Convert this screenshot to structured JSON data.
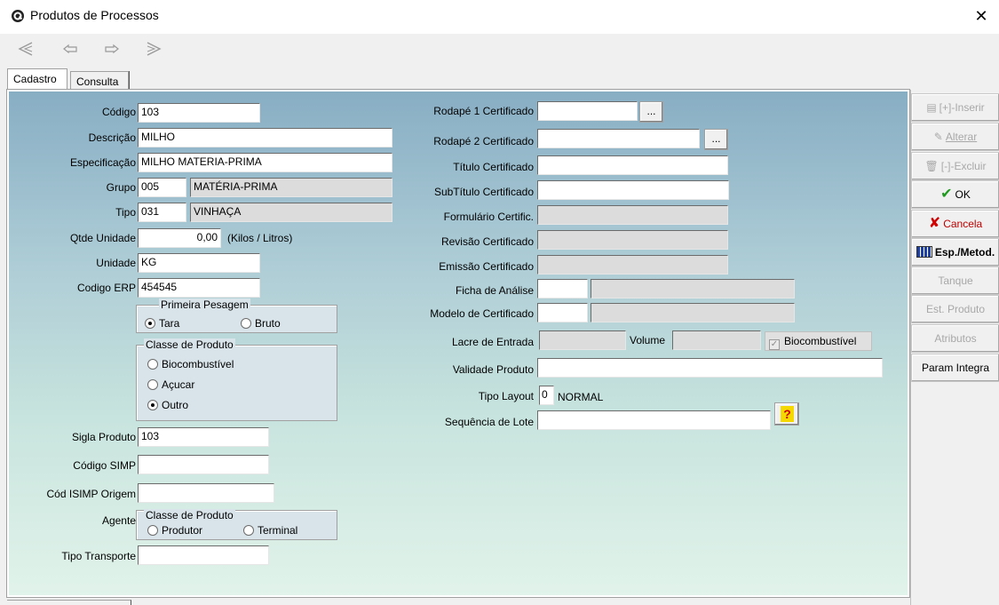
{
  "window": {
    "title": "Produtos de Processos",
    "close_icon": "✕"
  },
  "nav": {
    "first_icon": "first-icon",
    "prev_icon": "prev-icon",
    "next_icon": "next-icon",
    "last_icon": "last-icon"
  },
  "tabs": [
    {
      "label": "Cadastro",
      "active": true
    },
    {
      "label": "Consulta",
      "active": false
    }
  ],
  "form": {
    "codigo": {
      "label": "Código",
      "value": "103"
    },
    "descricao": {
      "label": "Descrição",
      "value": "MILHO"
    },
    "especificacao": {
      "label": "Especificação",
      "value": "MILHO MATERIA-PRIMA"
    },
    "grupo": {
      "label": "Grupo",
      "code": "005",
      "desc": "MATÉRIA-PRIMA"
    },
    "tipo": {
      "label": "Tipo",
      "code": "031",
      "desc": "VINHAÇA"
    },
    "qtde_unidade": {
      "label": "Qtde Unidade",
      "value": "0,00",
      "unit_hint": "(Kilos / Litros)"
    },
    "unidade": {
      "label": "Unidade",
      "value": "KG"
    },
    "codigo_erp": {
      "label": "Codigo ERP",
      "value": "454545"
    },
    "primeira_pesagem": {
      "title": "Primeira Pesagem",
      "options": [
        {
          "label": "Tara",
          "selected": true
        },
        {
          "label": "Bruto",
          "selected": false
        }
      ]
    },
    "classe_produto": {
      "title": "Classe de Produto",
      "options": [
        {
          "label": "Biocombustível",
          "selected": false
        },
        {
          "label": "Açucar",
          "selected": false
        },
        {
          "label": "Outro",
          "selected": true
        }
      ]
    },
    "sigla_produto": {
      "label": "Sigla Produto",
      "value": "103"
    },
    "codigo_simp": {
      "label": "Código SIMP",
      "value": ""
    },
    "cod_isimp_origem": {
      "label": "Cód  ISIMP  Origem",
      "value": ""
    },
    "agente": {
      "label": "Agente",
      "title": "Classe de Produto",
      "options": [
        {
          "label": "Produtor",
          "selected": false
        },
        {
          "label": "Terminal",
          "selected": false
        }
      ]
    },
    "tipo_transporte": {
      "label": "Tipo Transporte",
      "value": ""
    },
    "rodape1": {
      "label": "Rodapé 1 Certificado",
      "value": "",
      "button": "..."
    },
    "rodape2": {
      "label": "Rodapé 2 Certificado",
      "value": "",
      "button": "..."
    },
    "titulo_cert": {
      "label": "Título Certificado",
      "value": ""
    },
    "subtitulo_cert": {
      "label": "SubTítulo Certificado",
      "value": ""
    },
    "formulario_cert": {
      "label": "Formulário Certific.",
      "value": ""
    },
    "revisao_cert": {
      "label": "Revisão Certificado",
      "value": ""
    },
    "emissao_cert": {
      "label": "Emissão Certificado",
      "value": ""
    },
    "ficha_analise": {
      "label": "Ficha de Análise",
      "code": "",
      "desc": ""
    },
    "modelo_cert": {
      "label": "Modelo de Certificado",
      "code": "",
      "desc": ""
    },
    "lacre_entrada": {
      "label": "Lacre de Entrada",
      "value": ""
    },
    "volume": {
      "label": "Volume",
      "value": ""
    },
    "biocombustivel_check": {
      "label": "Biocombustível",
      "checked": true
    },
    "validade_produto": {
      "label": "Validade Produto",
      "value": ""
    },
    "tipo_layout": {
      "label": "Tipo Layout",
      "code": "0",
      "desc": "NORMAL"
    },
    "sequencia_lote": {
      "label": "Sequência de Lote",
      "value": "",
      "help": "?"
    }
  },
  "sidebar": {
    "inserir": "[+]-Inserir",
    "alterar": "Alterar",
    "excluir": "[-]-Excluir",
    "ok": "OK",
    "cancela": "Cancela",
    "esp_metod": "Esp./Metod.",
    "tanque": "Tanque",
    "est_produto": "Est. Produto",
    "atributos": "Atributos",
    "param_integra": "Param Integra"
  },
  "colors": {
    "panel_top": "#88aec4",
    "panel_bottom": "#e1f3ea",
    "ok_green": "#1e9b1e",
    "cancel_red": "#d00000"
  }
}
